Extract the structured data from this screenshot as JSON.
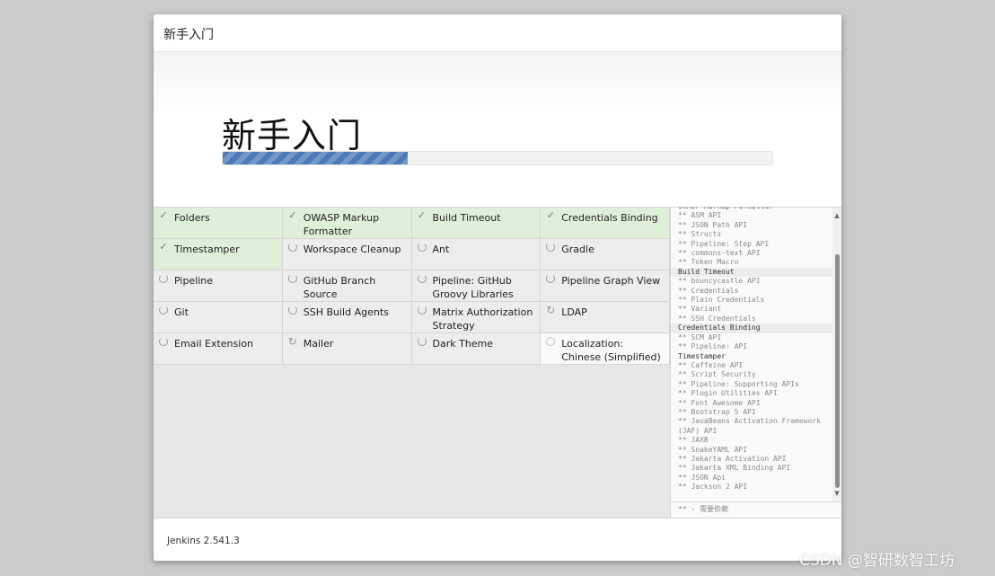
{
  "dialog": {
    "title": "新手入门",
    "banner_heading": "新手入门",
    "progress_fraction": 0.337,
    "accent_color": "#4a7bb7"
  },
  "plugins": [
    {
      "name": "Folders",
      "status": "done"
    },
    {
      "name": "OWASP Markup Formatter",
      "status": "done"
    },
    {
      "name": "Build Timeout",
      "status": "done"
    },
    {
      "name": "Credentials Binding",
      "status": "done"
    },
    {
      "name": "Timestamper",
      "status": "done"
    },
    {
      "name": "Workspace Cleanup",
      "status": "installing"
    },
    {
      "name": "Ant",
      "status": "installing"
    },
    {
      "name": "Gradle",
      "status": "installing"
    },
    {
      "name": "Pipeline",
      "status": "installing"
    },
    {
      "name": "GitHub Branch Source",
      "status": "installing"
    },
    {
      "name": "Pipeline: GitHub Groovy Libraries",
      "status": "installing"
    },
    {
      "name": "Pipeline Graph View",
      "status": "installing"
    },
    {
      "name": "Git",
      "status": "installing"
    },
    {
      "name": "SSH Build Agents",
      "status": "installing"
    },
    {
      "name": "Matrix Authorization Strategy",
      "status": "installing"
    },
    {
      "name": "LDAP",
      "status": "pending-retry"
    },
    {
      "name": "Email Extension",
      "status": "installing"
    },
    {
      "name": "Mailer",
      "status": "pending-retry"
    },
    {
      "name": "Dark Theme",
      "status": "installing"
    },
    {
      "name": "Localization: Chinese (Simplified)",
      "status": "pending"
    }
  ],
  "log": {
    "lines": [
      {
        "text": "OWASP Markup Formatter",
        "kind": "heading"
      },
      {
        "text": "** ASM API",
        "kind": "dep"
      },
      {
        "text": "** JSON Path API",
        "kind": "dep"
      },
      {
        "text": "** Structs",
        "kind": "dep"
      },
      {
        "text": "** Pipeline: Step API",
        "kind": "dep"
      },
      {
        "text": "** commons-text API",
        "kind": "dep"
      },
      {
        "text": "** Token Macro",
        "kind": "dep"
      },
      {
        "text": "Build Timeout",
        "kind": "heading-hl"
      },
      {
        "text": "** bouncycastle API",
        "kind": "dep"
      },
      {
        "text": "** Credentials",
        "kind": "dep"
      },
      {
        "text": "** Plain Credentials",
        "kind": "dep"
      },
      {
        "text": "** Variant",
        "kind": "dep"
      },
      {
        "text": "** SSH Credentials",
        "kind": "dep"
      },
      {
        "text": "Credentials Binding",
        "kind": "heading-hl"
      },
      {
        "text": "** SCM API",
        "kind": "dep"
      },
      {
        "text": "** Pipeline: API",
        "kind": "dep"
      },
      {
        "text": "Timestamper",
        "kind": "heading"
      },
      {
        "text": "** Caffeine API",
        "kind": "dep"
      },
      {
        "text": "** Script Security",
        "kind": "dep"
      },
      {
        "text": "** Pipeline: Supporting APIs",
        "kind": "dep"
      },
      {
        "text": "** Plugin Utilities API",
        "kind": "dep"
      },
      {
        "text": "** Font Awesome API",
        "kind": "dep"
      },
      {
        "text": "** Bootstrap 5 API",
        "kind": "dep"
      },
      {
        "text": "** JavaBeans Activation Framework",
        "kind": "dep"
      },
      {
        "text": "(JAF) API",
        "kind": "wrap"
      },
      {
        "text": "** JAXB",
        "kind": "dep"
      },
      {
        "text": "** SnakeYAML API",
        "kind": "dep"
      },
      {
        "text": "** Jakarta Activation API",
        "kind": "dep"
      },
      {
        "text": "** Jakarta XML Binding API",
        "kind": "dep"
      },
      {
        "text": "** JSON Api",
        "kind": "dep"
      },
      {
        "text": "** Jackson 2 API",
        "kind": "dep"
      }
    ],
    "legend": "** - 需要依赖",
    "scroll_up_glyph": "▲",
    "scroll_down_glyph": "▼"
  },
  "footer": {
    "version": "Jenkins 2.541.3"
  },
  "watermark": "CSDN @智研数智工坊"
}
